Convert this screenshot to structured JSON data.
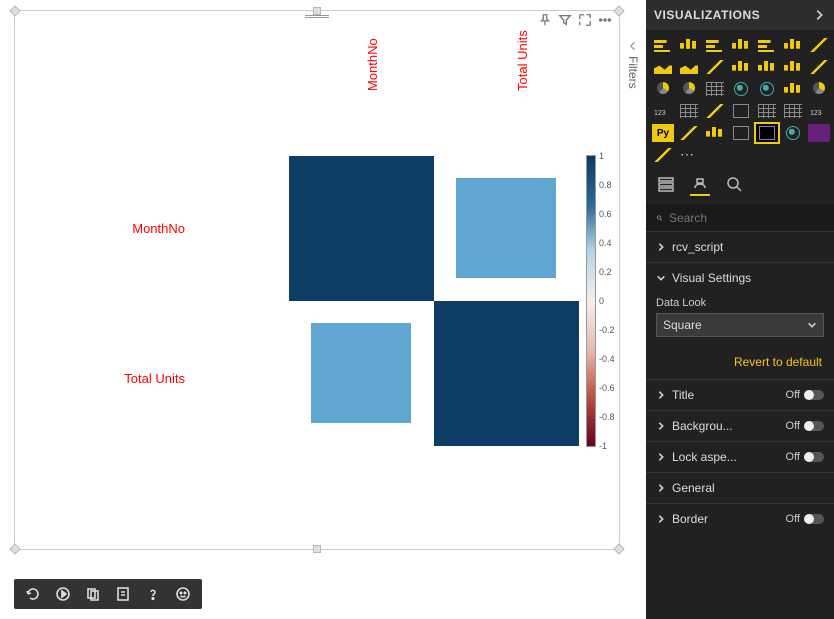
{
  "panel": {
    "title": "VISUALIZATIONS",
    "search_placeholder": "Search",
    "revert_label": "Revert to default",
    "sections": {
      "script": "rcv_script",
      "visual_settings": "Visual Settings",
      "data_look_label": "Data Look",
      "data_look_value": "Square",
      "title": "Title",
      "background": "Backgrou...",
      "lock_aspect": "Lock aspe...",
      "general": "General",
      "border": "Border"
    },
    "toggle_off": "Off"
  },
  "filters_label": "Filters",
  "chart_data": {
    "type": "heatmap",
    "variables": [
      "MonthNo",
      "Total Units"
    ],
    "matrix": [
      [
        1.0,
        0.6
      ],
      [
        0.6,
        1.0
      ]
    ],
    "colorbar": {
      "min": -1,
      "max": 1,
      "ticks": [
        1,
        0.8,
        0.6,
        0.4,
        0.2,
        0,
        -0.2,
        -0.4,
        -0.6,
        -0.8,
        -1
      ]
    },
    "data_look": "Square"
  }
}
